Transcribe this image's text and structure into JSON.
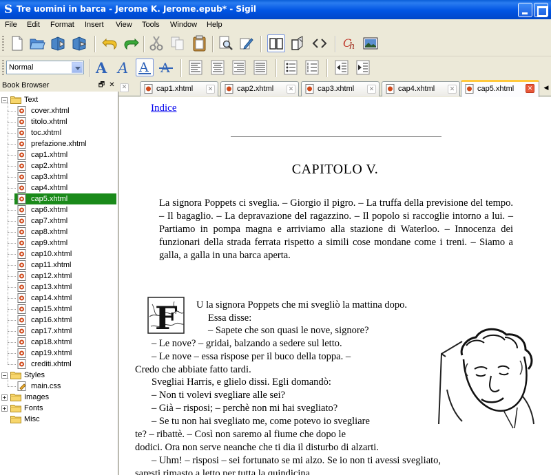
{
  "window": {
    "title": "Tre uomini in barca - Jerome K. Jerome.epub* - Sigil",
    "app_icon_glyph": "S"
  },
  "menu": [
    "File",
    "Edit",
    "Format",
    "Insert",
    "View",
    "Tools",
    "Window",
    "Help"
  ],
  "toolbar1": [
    {
      "icon": "new-file-icon"
    },
    {
      "icon": "open-folder-icon"
    },
    {
      "icon": "save-icon"
    },
    {
      "icon": "save-as-icon"
    },
    {
      "icon": "undo-icon"
    },
    {
      "icon": "redo-icon"
    },
    {
      "icon": "cut-icon"
    },
    {
      "icon": "copy-icon"
    },
    {
      "icon": "paste-icon"
    },
    {
      "icon": "find-replace-icon"
    },
    {
      "icon": "meta-editor-icon"
    },
    {
      "icon": "book-view-icon"
    },
    {
      "icon": "split-view-icon"
    },
    {
      "icon": "code-view-icon"
    },
    {
      "icon": "tidy-icon"
    },
    {
      "icon": "insert-image-icon"
    }
  ],
  "toolbar2": {
    "style_select": "Normal",
    "buttons": [
      "bold-icon",
      "italic-icon",
      "underline-icon",
      "strikethrough-icon",
      "align-left-icon",
      "align-center-icon",
      "align-right-icon",
      "justify-icon",
      "bullet-list-icon",
      "numbered-list-icon",
      "decrease-indent-icon",
      "increase-indent-icon"
    ]
  },
  "book_browser": {
    "header": "Book Browser",
    "float_glyph": "🗗",
    "close_glyph": "✕",
    "folders": [
      {
        "name": "Text",
        "expanded": true,
        "expander": "−"
      },
      {
        "name": "Styles",
        "expanded": true,
        "expander": "−"
      },
      {
        "name": "Images",
        "expanded": false,
        "expander": "+"
      },
      {
        "name": "Fonts",
        "expanded": false,
        "expander": "+"
      },
      {
        "name": "Misc",
        "expanded": false,
        "expander": ""
      }
    ],
    "text_files": [
      "cover.xhtml",
      "titolo.xhtml",
      "toc.xhtml",
      "prefazione.xhtml",
      "cap1.xhtml",
      "cap2.xhtml",
      "cap3.xhtml",
      "cap4.xhtml",
      "cap5.xhtml",
      "cap6.xhtml",
      "cap7.xhtml",
      "cap8.xhtml",
      "cap9.xhtml",
      "cap10.xhtml",
      "cap11.xhtml",
      "cap12.xhtml",
      "cap13.xhtml",
      "cap14.xhtml",
      "cap15.xhtml",
      "cap16.xhtml",
      "cap17.xhtml",
      "cap18.xhtml",
      "cap19.xhtml",
      "crediti.xhtml"
    ],
    "style_files": [
      "main.css"
    ],
    "selected": "cap5.xhtml",
    "selected_color": "#1a8a1a"
  },
  "tabs": {
    "items": [
      "cap1.xhtml",
      "cap2.xhtml",
      "cap3.xhtml",
      "cap4.xhtml",
      "cap5.xhtml"
    ],
    "active": "cap5.xhtml",
    "close_glyph": "✕",
    "scroll_glyph": "◀"
  },
  "document": {
    "index_link": "Indice",
    "chapter_title": "CAPITOLO V.",
    "summary": "La signora Poppets ci sveglia. – Giorgio il pigro. – La truffa della previsione del tempo. – Il bagaglio. – La depravazione del ragazzino. – Il popolo si raccoglie intorno a lui. – Partiamo in pompa magna e arriviamo alla stazione di Waterloo. – Innocenza dei funzionari della strada ferrata rispetto a simili cose mondane come i treni. – Siamo a galla, a galla in una barca aperta.",
    "dropcap_letter": "F",
    "lines": [
      "U la signora Poppets che mi svegliò la mattina dopo.",
      "Essa disse:",
      "– Sapete che son quasi le nove, signore?",
      "– Le nove? – gridai, balzando a sedere sul letto.",
      "– Le nove – essa rispose per il buco della toppa. –",
      "Credo che abbiate fatto tardi.",
      "Svegliai Harris, e glielo dissi. Egli domandò:",
      "– Non ti volevi svegliare alle sei?",
      "– Già – risposi; – perchè non mi hai svegliato?",
      "– Se tu non hai svegliato me, come potevo io svegliare",
      "te? – ribattè. – Così non saremo al fiume che dopo le",
      "dodici. Ora non serve neanche che ti dia il disturbo di alzarti.",
      "– Uhm! – risposi – sei fortunato se mi alzo. Se io non ti avessi svegliato,",
      "saresti rimasto a letto per tutta la quindicina."
    ]
  },
  "colors": {
    "titlebar": "#0054e3",
    "chrome": "#ece9d8",
    "link": "#0000ee",
    "active_tab_accent": "#ffc83c"
  }
}
